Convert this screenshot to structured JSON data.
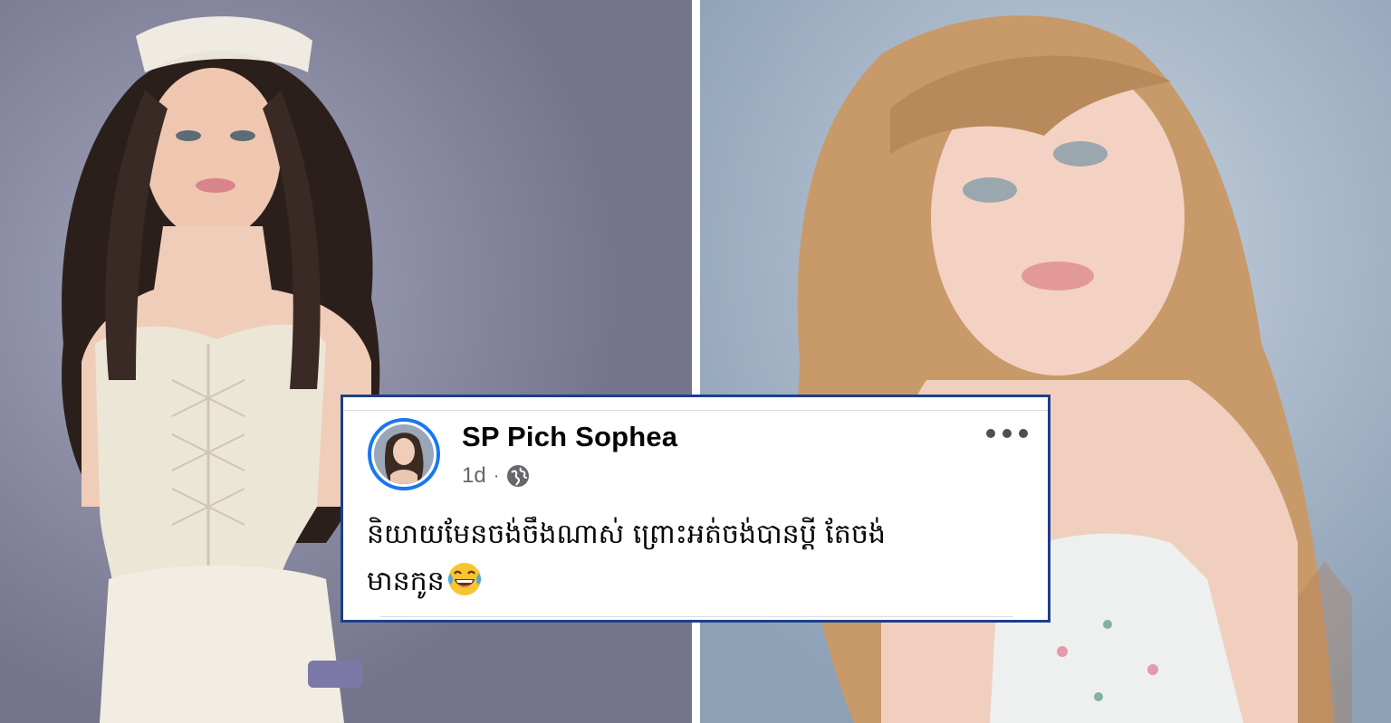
{
  "photos": {
    "left_alt": "woman-in-white-lace-corset-photo",
    "right_alt": "woman-with-blonde-hair-photo"
  },
  "post": {
    "author_name": "SP Pich Sophea",
    "timestamp": "1d",
    "separator": "·",
    "privacy_icon": "globe-icon",
    "more_icon": "more-options-icon",
    "text_line_1": "និយាយមែនចង់ចឹងណាស់ ព្រោះអត់ចង់បានប្ដី តែចង់",
    "text_line_2": "មានកូន",
    "emoji_icon": "laughing-tears-emoji-icon"
  },
  "colors": {
    "card_border": "#1d3f8c",
    "avatar_ring": "#1877f2",
    "name_text": "#050505",
    "meta_text": "#65676b"
  }
}
